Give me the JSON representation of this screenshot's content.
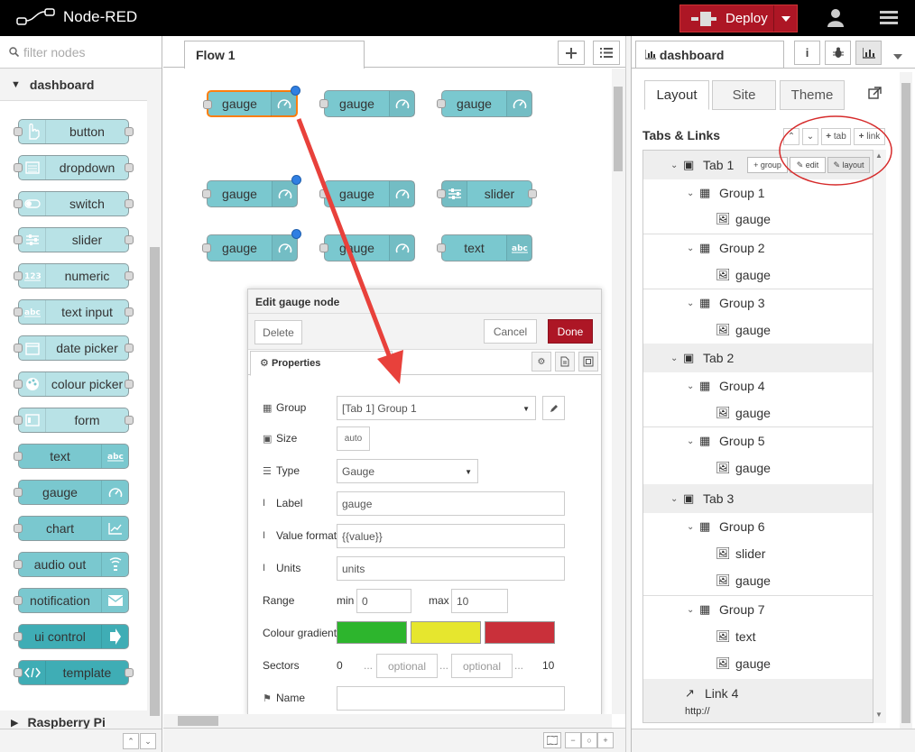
{
  "header": {
    "app_title": "Node-RED",
    "deploy_label": "Deploy"
  },
  "palette": {
    "filter_placeholder": "filter nodes",
    "category": "dashboard",
    "category2": "Raspberry Pi",
    "nodes": [
      {
        "label": "button",
        "icon": "hand-pointer-icon"
      },
      {
        "label": "dropdown",
        "icon": "list-icon"
      },
      {
        "label": "switch",
        "icon": "toggle-icon"
      },
      {
        "label": "slider",
        "icon": "sliders-icon"
      },
      {
        "label": "numeric",
        "icon": "numeric-123-icon"
      },
      {
        "label": "text input",
        "icon": "abc-icon"
      },
      {
        "label": "date picker",
        "icon": "calendar-icon"
      },
      {
        "label": "colour picker",
        "icon": "palette-icon"
      },
      {
        "label": "form",
        "icon": "form-icon"
      },
      {
        "label": "text",
        "icon": "abc-icon"
      },
      {
        "label": "gauge",
        "icon": "gauge-icon"
      },
      {
        "label": "chart",
        "icon": "chart-icon"
      },
      {
        "label": "audio out",
        "icon": "audio-icon"
      },
      {
        "label": "notification",
        "icon": "envelope-icon"
      },
      {
        "label": "ui control",
        "icon": "arrow-right-icon"
      },
      {
        "label": "template",
        "icon": "code-icon"
      }
    ]
  },
  "workspace": {
    "flow_tab": "Flow 1",
    "canvas_nodes": [
      {
        "label": "gauge"
      },
      {
        "label": "gauge"
      },
      {
        "label": "gauge"
      },
      {
        "label": "gauge"
      },
      {
        "label": "gauge"
      },
      {
        "label": "slider"
      },
      {
        "label": "gauge"
      },
      {
        "label": "gauge"
      },
      {
        "label": "text"
      }
    ]
  },
  "edit_dialog": {
    "title": "Edit gauge node",
    "delete_label": "Delete",
    "cancel_label": "Cancel",
    "done_label": "Done",
    "properties_tab": "Properties",
    "fields": {
      "group_label": "Group",
      "group_value": "[Tab 1] Group 1",
      "size_label": "Size",
      "size_value": "auto",
      "type_label": "Type",
      "type_value": "Gauge",
      "label_label": "Label",
      "label_value": "gauge",
      "value_format_label": "Value format",
      "value_format_value": "{{value}}",
      "units_label": "Units",
      "units_value": "units",
      "range_label": "Range",
      "min_label": "min",
      "min_value": "0",
      "max_label": "max",
      "max_value": "10",
      "colour_gradient_label": "Colour gradient",
      "colours": [
        "#2db52d",
        "#e6e62e",
        "#c9303a"
      ],
      "sectors_label": "Sectors",
      "sector_start": "0",
      "sector_dots1": "...",
      "sector_opt1": "optional",
      "sector_dots2": "...",
      "sector_opt2": "optional",
      "sector_dots3": "...",
      "sector_end": "10",
      "name_label": "Name",
      "name_value": ""
    }
  },
  "sidebar": {
    "tab_label": "dashboard",
    "subtabs": [
      "Layout",
      "Site",
      "Theme"
    ],
    "tabs_links_title": "Tabs & Links",
    "header_buttons": {
      "tab": "tab",
      "link": "link"
    },
    "row_buttons": {
      "group": "group",
      "edit": "edit",
      "layout": "layout"
    },
    "tree": [
      {
        "kind": "tab",
        "label": "Tab 1"
      },
      {
        "kind": "group",
        "label": "Group 1"
      },
      {
        "kind": "widget",
        "label": "gauge"
      },
      {
        "kind": "group",
        "label": "Group 2"
      },
      {
        "kind": "widget",
        "label": "gauge"
      },
      {
        "kind": "group",
        "label": "Group 3"
      },
      {
        "kind": "widget",
        "label": "gauge"
      },
      {
        "kind": "tab",
        "label": "Tab 2"
      },
      {
        "kind": "group",
        "label": "Group 4"
      },
      {
        "kind": "widget",
        "label": "gauge"
      },
      {
        "kind": "group",
        "label": "Group 5"
      },
      {
        "kind": "widget",
        "label": "gauge"
      },
      {
        "kind": "tab",
        "label": "Tab 3"
      },
      {
        "kind": "group",
        "label": "Group 6"
      },
      {
        "kind": "widget",
        "label": "slider"
      },
      {
        "kind": "widget",
        "label": "gauge"
      },
      {
        "kind": "group",
        "label": "Group 7"
      },
      {
        "kind": "widget",
        "label": "text"
      },
      {
        "kind": "widget",
        "label": "gauge"
      }
    ],
    "link": {
      "label": "Link 4",
      "url": "http://"
    }
  },
  "colors": {
    "deploy": "#ad1625",
    "node_fill": "#7ac8cf",
    "palette_node_fill": "#b8e2e6",
    "arrow": "#e8413b",
    "highlight_circle": "#d62b2b",
    "selection_dot": "#307fe2"
  }
}
